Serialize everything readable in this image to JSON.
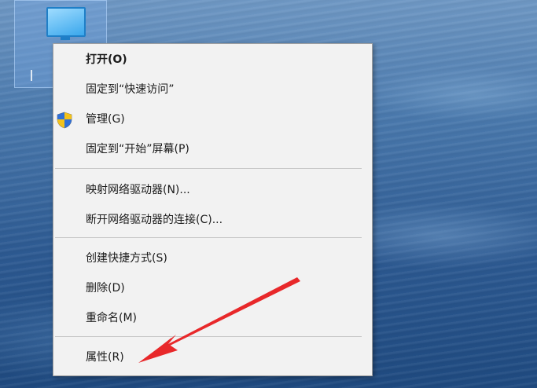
{
  "desktop": {
    "selected_icon": "this-pc-icon"
  },
  "context_menu": {
    "items": [
      {
        "label": "打开(O)",
        "default": true
      },
      {
        "label": "固定到“快速访问”"
      },
      {
        "label": "管理(G)",
        "icon": "uac-shield-icon"
      },
      {
        "label": "固定到“开始”屏幕(P)"
      },
      {
        "label": "映射网络驱动器(N)..."
      },
      {
        "label": "断开网络驱动器的连接(C)..."
      },
      {
        "label": "创建快捷方式(S)"
      },
      {
        "label": "删除(D)"
      },
      {
        "label": "重命名(M)"
      },
      {
        "label": "属性(R)"
      }
    ]
  },
  "annotation": {
    "arrow_color": "#e8282a",
    "points_to": "属性(R)"
  },
  "colors": {
    "menu_background": "#f2f2f2",
    "desktop_blue": "#2d5a92"
  }
}
